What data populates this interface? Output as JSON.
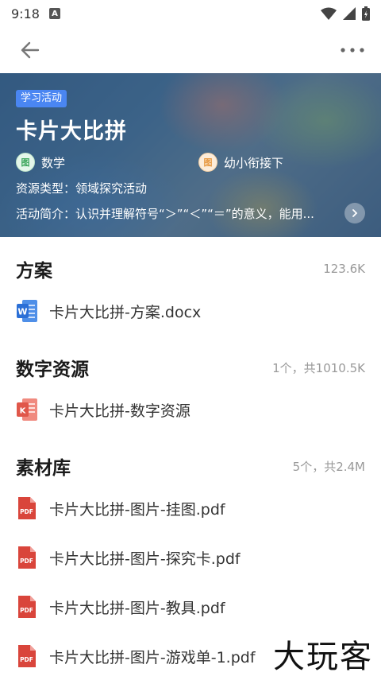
{
  "status_bar": {
    "time": "9:18",
    "a_badge": "A"
  },
  "header": {
    "back_icon": "arrow-left-icon",
    "more_icon": "more-horizontal-icon"
  },
  "banner": {
    "tag": "学习活动",
    "title": "卡片大比拼",
    "subject_icon_text": "图",
    "subject": "数学",
    "grade_icon_text": "图",
    "grade": "幼小衔接下",
    "resource_type": "资源类型：领域探究活动",
    "intro": "活动简介：认识并理解符号“＞”“＜”“＝”的意义，能用..."
  },
  "sections": {
    "plan": {
      "title": "方案",
      "size": "123.6K",
      "files": [
        {
          "name": "卡片大比拼-方案.docx",
          "icon": "word-icon"
        }
      ]
    },
    "digital": {
      "title": "数字资源",
      "size": "1个，共1010.5K",
      "files": [
        {
          "name": "卡片大比拼-数字资源",
          "icon": "presentation-icon"
        }
      ]
    },
    "materials": {
      "title": "素材库",
      "size": "5个，共2.4M",
      "files": [
        {
          "name": "卡片大比拼-图片-挂图.pdf",
          "icon": "pdf-icon"
        },
        {
          "name": "卡片大比拼-图片-探究卡.pdf",
          "icon": "pdf-icon"
        },
        {
          "name": "卡片大比拼-图片-教具.pdf",
          "icon": "pdf-icon"
        },
        {
          "name": "卡片大比拼-图片-游戏单-1.pdf",
          "icon": "pdf-icon"
        }
      ]
    }
  },
  "watermark": "大玩客",
  "colors": {
    "tag_bg": "#4a86f2",
    "word_blue": "#2b6fd6",
    "pdf_red": "#d9453b",
    "ppt_red": "#e0574a"
  }
}
